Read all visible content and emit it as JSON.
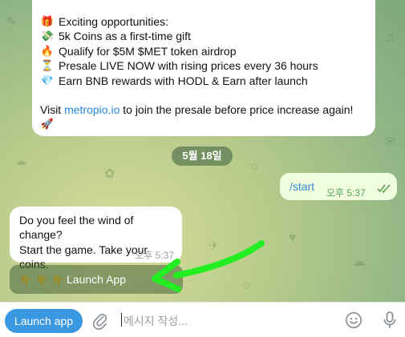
{
  "top_message": {
    "lines": [
      {
        "emoji": "🎁",
        "text": "Exciting opportunities:"
      },
      {
        "emoji": "💸",
        "text": "5k Coins as a first-time gift"
      },
      {
        "emoji": "🔥",
        "text": "Qualify for $5M $MET token airdrop"
      },
      {
        "emoji": "⏳",
        "text": "Presale LIVE NOW with rising prices every 36 hours"
      },
      {
        "emoji": "💎",
        "text": "Earn BNB rewards with HODL & Earn after launch"
      }
    ],
    "visit_prefix": "Visit ",
    "link": "metropio.io",
    "visit_suffix": " to join the presale before price increase again!",
    "rocket": "🚀"
  },
  "date_chip": "5월 18일",
  "outgoing": {
    "text": "/start",
    "time": "오후 5:37"
  },
  "bot_message": {
    "line1": "Do you feel the wind of change?",
    "line2": "Start the game. Take your coins.",
    "hands": "👇👇👇",
    "time": "오후 5:37"
  },
  "keyboard_button": "Launch App",
  "input_bar": {
    "launch_label": "Launch app",
    "placeholder": "메시지 작성..."
  },
  "colors": {
    "accent": "#3a98e0",
    "annotation_arrow": "#22ee22",
    "outgoing_bubble": "#effdde"
  }
}
